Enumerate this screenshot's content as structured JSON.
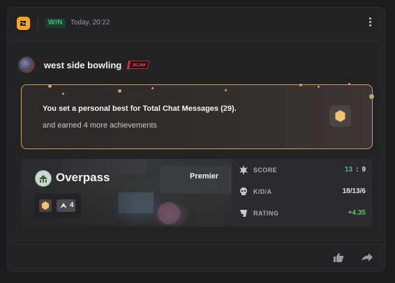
{
  "header": {
    "logo_icon": "faceit-logo-icon",
    "result": "WIN",
    "time": "Today, 20:22",
    "menu_icon": "kebab-menu-icon"
  },
  "user": {
    "name": "west side bowling",
    "rank_rating": "26,289"
  },
  "achievement": {
    "title": "You set a personal best for Total Chat Messages (29).",
    "subtitle": "and earned 4 more achievements",
    "icon": "hexagon-medal-icon"
  },
  "match": {
    "map_name": "Overpass",
    "mode": "Premier",
    "rank_badge": "4",
    "stats": [
      {
        "label": "SCORE",
        "icon": "burst-icon",
        "team_score": "13",
        "enemy_score": "9"
      },
      {
        "label": "K/D/A",
        "icon": "skull-icon",
        "value": "18/13/6"
      },
      {
        "label": "RATING",
        "icon": "rating-icon",
        "value": "+4.35"
      }
    ]
  },
  "footer": {
    "like_icon": "thumbs-up-icon",
    "share_icon": "share-icon"
  },
  "colors": {
    "win": "#3fbf7f",
    "accent_gold": "#c8a15e",
    "score_team": "#3fbfa0",
    "rating_positive": "#5fc76a",
    "rank_red": "#e02c3a"
  }
}
